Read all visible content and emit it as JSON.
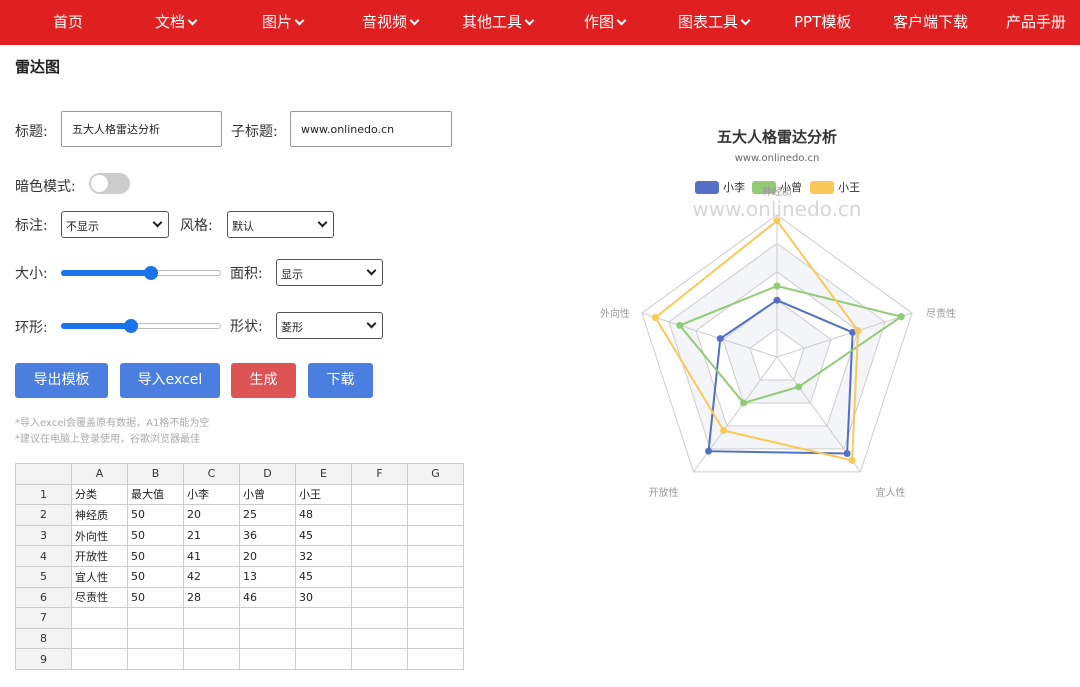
{
  "nav": {
    "items": [
      {
        "label": "首页",
        "dropdown": false
      },
      {
        "label": "文档",
        "dropdown": true
      },
      {
        "label": "图片",
        "dropdown": true
      },
      {
        "label": "音视频",
        "dropdown": true
      },
      {
        "label": "其他工具",
        "dropdown": true
      },
      {
        "label": "作图",
        "dropdown": true
      },
      {
        "label": "图表工具",
        "dropdown": true
      },
      {
        "label": "PPT模板",
        "dropdown": false
      },
      {
        "label": "客户端下载",
        "dropdown": false
      },
      {
        "label": "产品手册",
        "dropdown": false
      }
    ]
  },
  "page": {
    "title": "雷达图"
  },
  "form": {
    "title_label": "标题:",
    "title_value": "五大人格雷达分析",
    "subtitle_label": "子标题:",
    "subtitle_value": "www.onlinedo.cn",
    "dark_mode_label": "暗色模式:",
    "dark_mode_on": false,
    "annotation_label": "标注:",
    "annotation_value": "不显示",
    "style_label": "风格:",
    "style_value": "默认",
    "size_label": "大小:",
    "size_level": 0.56,
    "area_label": "面积:",
    "area_value": "显示",
    "ring_label": "环形:",
    "ring_level": 0.44,
    "shape_label": "形状:",
    "shape_value": "菱形"
  },
  "buttons": {
    "export_template": "导出模板",
    "import_excel": "导入excel",
    "generate": "生成",
    "download": "下载"
  },
  "notes": [
    "*导入excel会覆盖原有数据，A1格不能为空",
    "*建议在电脑上登录使用，谷歌浏览器最佳"
  ],
  "sheet": {
    "columns": [
      "",
      "A",
      "B",
      "C",
      "D",
      "E",
      "F",
      "G"
    ],
    "rows": [
      [
        "1",
        "分类",
        "最大值",
        "小李",
        "小曾",
        "小王",
        "",
        ""
      ],
      [
        "2",
        "神经质",
        "50",
        "20",
        "25",
        "48",
        "",
        ""
      ],
      [
        "3",
        "外向性",
        "50",
        "21",
        "36",
        "45",
        "",
        ""
      ],
      [
        "4",
        "开放性",
        "50",
        "41",
        "20",
        "32",
        "",
        ""
      ],
      [
        "5",
        "宜人性",
        "50",
        "42",
        "13",
        "45",
        "",
        ""
      ],
      [
        "6",
        "尽责性",
        "50",
        "28",
        "46",
        "30",
        "",
        ""
      ],
      [
        "7",
        "",
        "",
        "",
        "",
        "",
        "",
        ""
      ],
      [
        "8",
        "",
        "",
        "",
        "",
        "",
        "",
        ""
      ],
      [
        "9",
        "",
        "",
        "",
        "",
        "",
        "",
        ""
      ]
    ]
  },
  "watermark": "www.onlinedo.cn",
  "chart_data": {
    "type": "radar",
    "title": "五大人格雷达分析",
    "subtitle": "www.onlinedo.cn",
    "indicators": [
      "神经质",
      "尽责性",
      "宜人性",
      "开放性",
      "外向性"
    ],
    "max": 50,
    "shape": "polygon",
    "area": true,
    "legend_position": "top",
    "series": [
      {
        "name": "小李",
        "color": "#5470c6",
        "values": [
          20,
          28,
          42,
          41,
          21
        ]
      },
      {
        "name": "小曾",
        "color": "#91cc75",
        "values": [
          25,
          46,
          13,
          20,
          36
        ]
      },
      {
        "name": "小王",
        "color": "#fac858",
        "values": [
          48,
          30,
          45,
          32,
          45
        ]
      }
    ]
  }
}
